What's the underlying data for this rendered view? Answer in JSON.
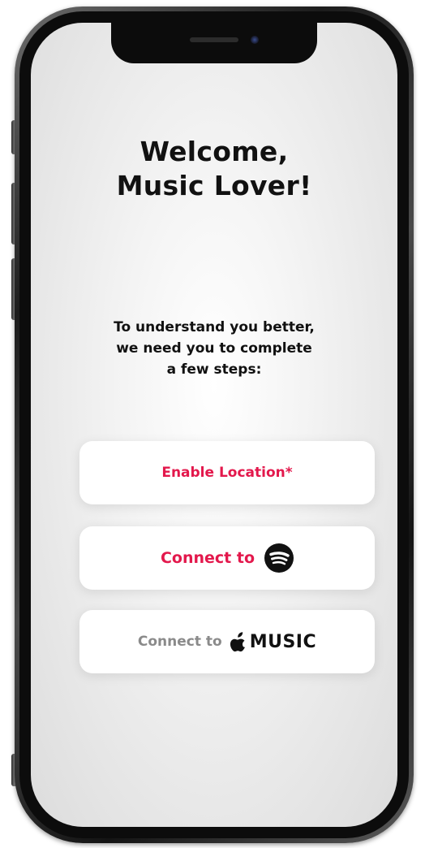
{
  "welcome": {
    "title_line1": "Welcome,",
    "title_line2": "Music Lover!",
    "subtitle_line1": "To understand you better,",
    "subtitle_line2": "we need you to complete",
    "subtitle_line3": "a few steps:"
  },
  "buttons": {
    "location_label": "Enable Location*",
    "spotify_label": "Connect to",
    "spotify_icon": "spotify-logo",
    "apple_label": "Connect to",
    "apple_icon": "apple-logo",
    "apple_music_word": "MUSIC"
  },
  "colors": {
    "accent": "#e3184c",
    "muted": "#8a8a8a",
    "text": "#111111"
  }
}
